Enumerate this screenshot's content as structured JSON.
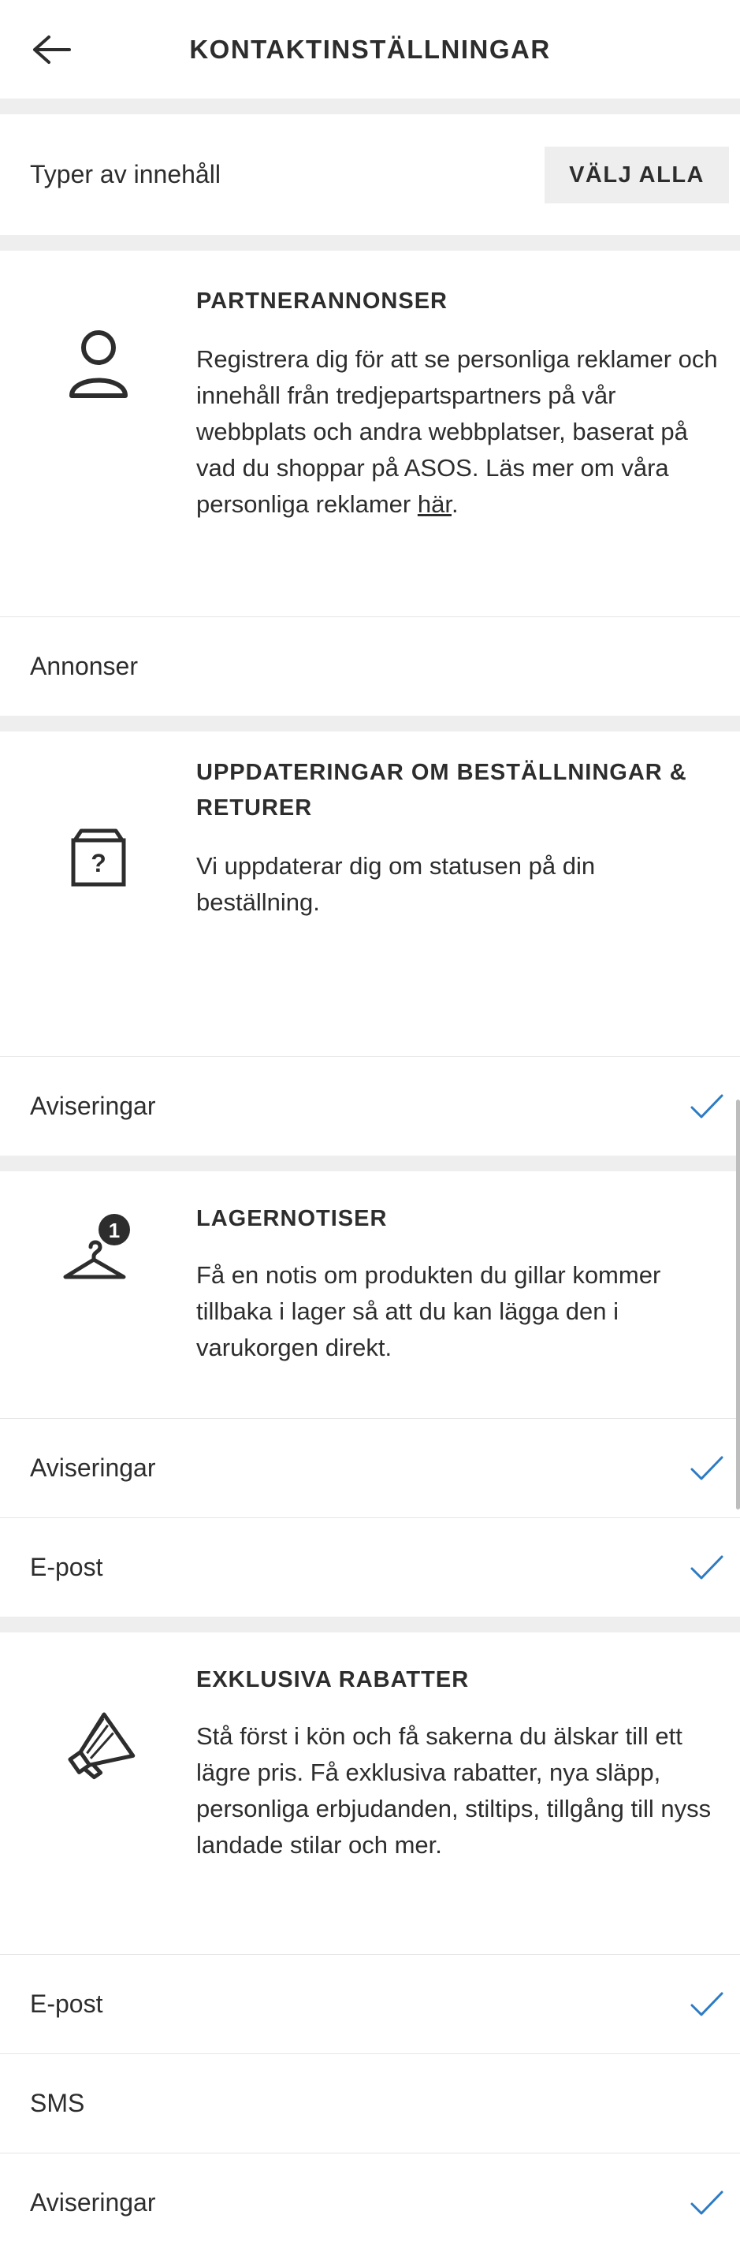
{
  "header": {
    "title": "KONTAKTINSTÄLLNINGAR",
    "back_icon": "arrow-left-icon"
  },
  "types": {
    "label": "Typer av innehåll",
    "select_all": "VÄLJ ALLA"
  },
  "sections": [
    {
      "icon": "user-icon",
      "title": "PARTNERANNONSER",
      "description_pre": "Registrera dig för att se personliga reklamer och innehåll från tredjepartspartners på vår webbplats och andra webbplatser, baserat på vad du shoppar på ASOS. Läs mer om våra personliga reklamer ",
      "description_link": "här",
      "description_post": ".",
      "rows": [
        {
          "label": "Annonser",
          "checked": false
        }
      ]
    },
    {
      "icon": "package-question-icon",
      "title": "UPPDATERINGAR OM BESTÄLLNINGAR & RETURER",
      "description": "Vi uppdaterar dig om statusen på din beställning.",
      "rows": [
        {
          "label": "Aviseringar",
          "checked": true
        }
      ]
    },
    {
      "icon": "hanger-badge-icon",
      "badge": "1",
      "title": "LAGERNOTISER",
      "description": "Få en notis om produkten du gillar kommer tillbaka i lager så att du kan lägga den i varukorgen direkt.",
      "rows": [
        {
          "label": "Aviseringar",
          "checked": true
        },
        {
          "label": "E-post",
          "checked": true
        }
      ]
    },
    {
      "icon": "megaphone-icon",
      "title": "EXKLUSIVA RABATTER",
      "description": "Stå först i kön och få sakerna du älskar till ett lägre pris. Få exklusiva rabatter, nya släpp, personliga erbjudanden, stiltips, tillgång till nyss landade stilar och mer.",
      "rows": [
        {
          "label": "E-post",
          "checked": true
        },
        {
          "label": "SMS",
          "checked": false
        },
        {
          "label": "Aviseringar",
          "checked": true
        }
      ]
    }
  ],
  "colors": {
    "check": "#2d7bc4",
    "divider": "#eeeeee",
    "text": "#2d2d2d"
  }
}
